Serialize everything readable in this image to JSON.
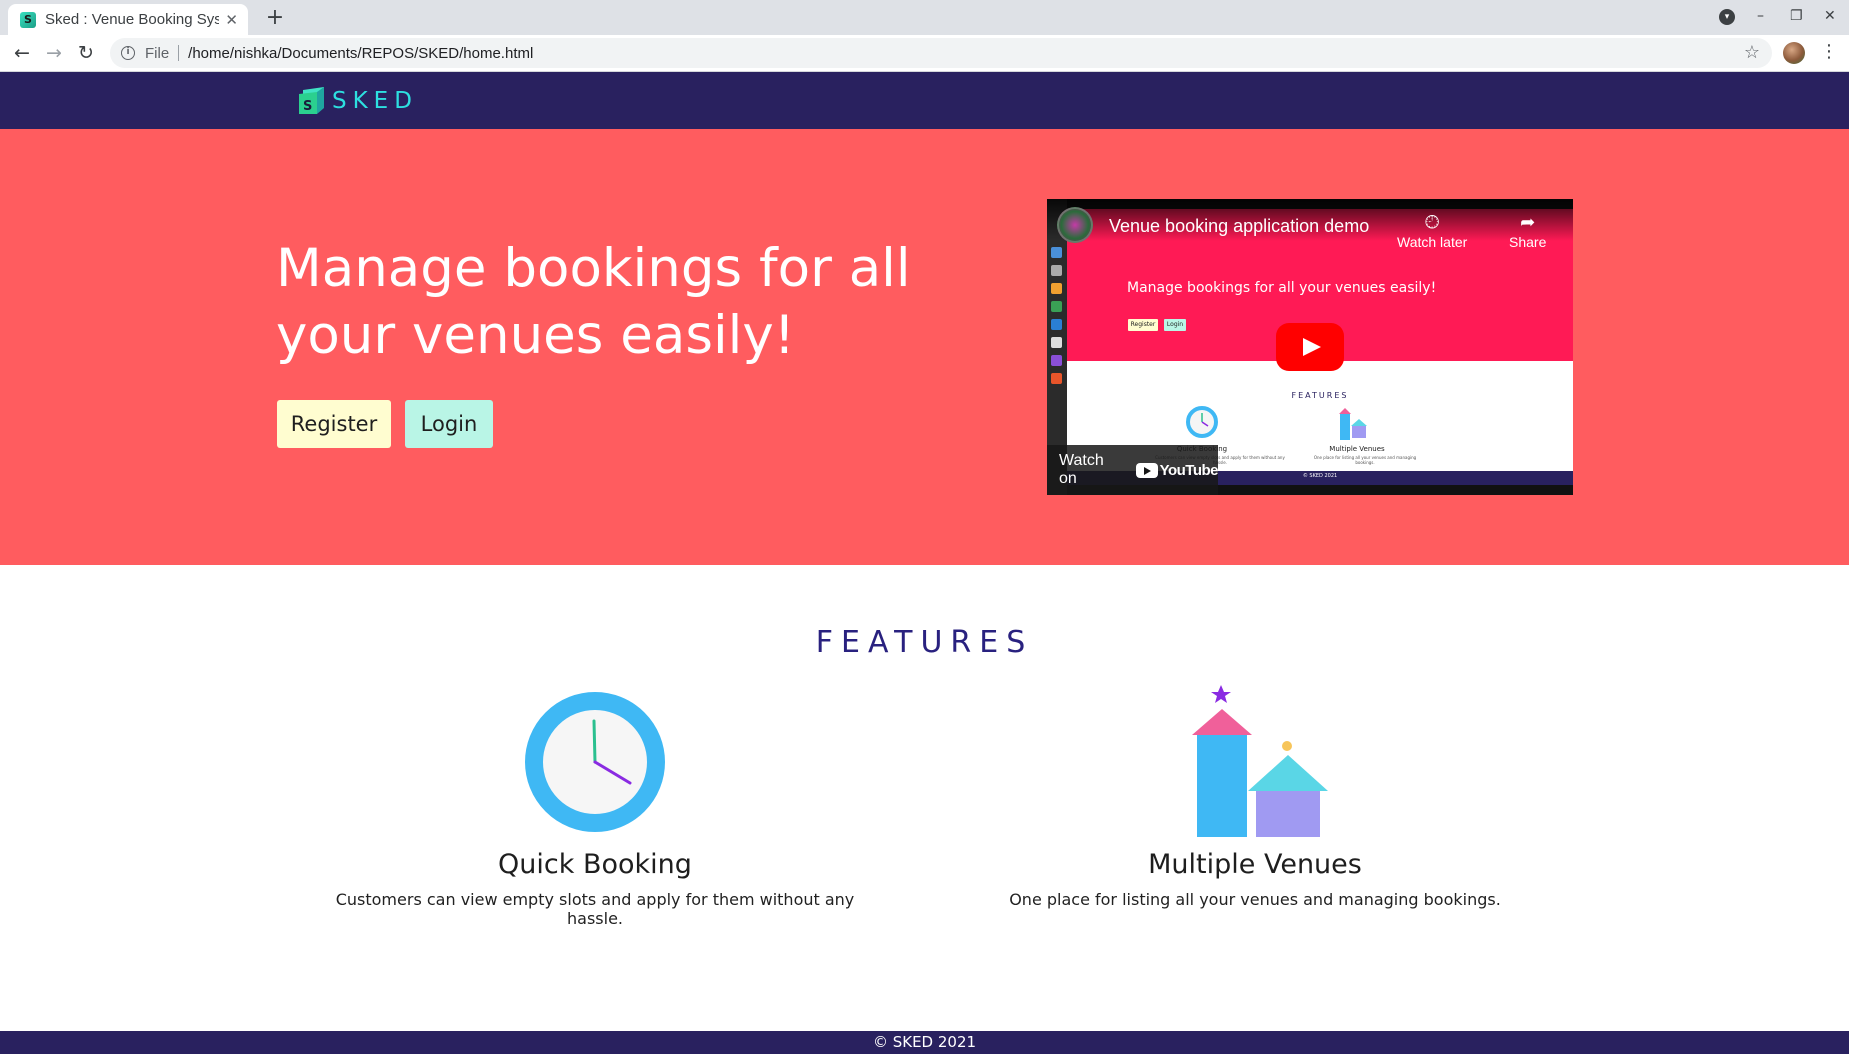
{
  "browser": {
    "tab_title": "Sked : Venue Booking System",
    "tab_favicon_letter": "S",
    "scheme_label": "File",
    "url": "/home/nishka/Documents/REPOS/SKED/home.html"
  },
  "navbar": {
    "brand": "SKED"
  },
  "hero": {
    "headline": "Manage bookings for all your venues easily!",
    "register_label": "Register",
    "login_label": "Login"
  },
  "video": {
    "title": "Venue booking application demo",
    "watch_later_label": "Watch later",
    "share_label": "Share",
    "watch_on_label": "Watch on",
    "youtube_label": "YouTube",
    "inner_headline": "Manage bookings for all your venues easily!",
    "inner_register": "Register",
    "inner_login": "Login",
    "inner_features": "FEATURES",
    "inner_feature_1": "Quick Booking",
    "inner_feature_2": "Multiple Venues",
    "inner_feature_1_desc": "Customers can view empty slots and apply for them without any hassle.",
    "inner_feature_2_desc": "One place for listing all your venues and managing bookings.",
    "inner_footer": "© SKED 2021"
  },
  "features": {
    "heading": "FEATURES",
    "items": [
      {
        "title": "Quick Booking",
        "description": "Customers can view empty slots and apply for them without any hassle.",
        "icon": "clock-icon"
      },
      {
        "title": "Multiple Venues",
        "description": "One place for listing all your venues and managing bookings.",
        "icon": "buildings-icon"
      }
    ]
  },
  "footer": {
    "text": "© SKED 2021"
  },
  "colors": {
    "navbar": "#29215f",
    "hero": "#ff5c5f",
    "brand_text": "#2de0e0",
    "register_button": "#fffdd0",
    "login_button": "#b9f5e6",
    "features_heading": "#29217f"
  }
}
